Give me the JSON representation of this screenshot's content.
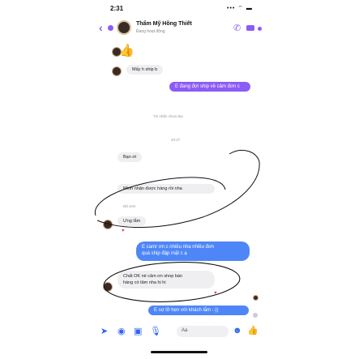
{
  "status_bar": {
    "time": "2:31",
    "icons": "••• ⌔ ▬"
  },
  "header": {
    "back": "‹",
    "contact_name": "Thẩm Mỹ Hồng Thiết",
    "contact_status": "Đang hoạt động",
    "accent": "#8b5cf6"
  },
  "messages": {
    "like": "👍",
    "received_1": "Mấy h ship b",
    "sent_1": "E đang đợi ship về cảm đơn c",
    "unread_divider": "Tin nhắn chưa đọc",
    "time_1": "20:27",
    "received_2": "Bạn ơi",
    "received_3": "Mình nhận được hàng rồi nha",
    "seen_label": "Đã xem",
    "received_4": "Ưng lắm",
    "sent_2_line1": "E camr ơn c nhiều nha nhiều đơn",
    "sent_2_line2": "quá ship đập mặt c ạ",
    "received_5_line1": "Chất OK nè cảm ơn shop bán",
    "received_5_line2": "hàng có tâm nha hi hi",
    "sent_3": "E sợ lỡ hẹn với khách lắm :-))"
  },
  "composer": {
    "placeholder": "Aa"
  },
  "colors": {
    "purple": "#8b5cf6",
    "blue": "#4f86f7",
    "gray_bubble": "#efeff2",
    "annotation": "#111111"
  }
}
